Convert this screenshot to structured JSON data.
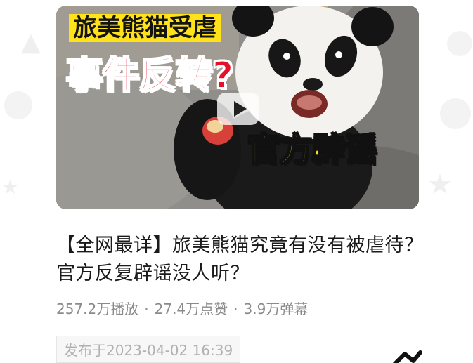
{
  "video": {
    "thumbnail_caption_top": "旅美熊猫受虐",
    "thumbnail_caption_middle": "事件反转?",
    "thumbnail_caption_bottom": "官方辟谣",
    "play_icon": "play-icon"
  },
  "title": "【全网最详】旅美熊猫究竟有没有被虐待？官方反复辟谣没人听？",
  "stats": {
    "plays": "257.2万播放",
    "likes": "27.4万点赞",
    "danmaku": "3.9万弹幕",
    "separator": "·"
  },
  "publish": {
    "text": "发布于2023-04-02 16:39"
  },
  "colors": {
    "caption_yellow": "#ffe21a",
    "caption_red": "#e5102a",
    "meta_gray": "#8a8a8a",
    "title_black": "#1a1a1a"
  }
}
